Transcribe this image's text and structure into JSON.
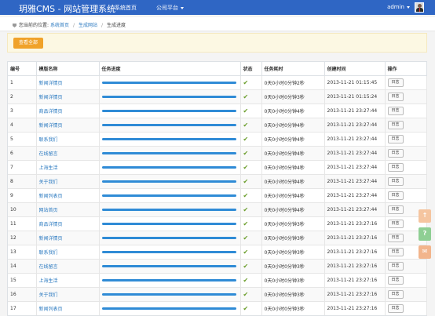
{
  "navbar": {
    "brand": "玥雅CMS - 网站管理系统",
    "home_link": "系统首页",
    "platform_link": "公司平台",
    "user": "admin"
  },
  "breadcrumb": {
    "prefix": "您当前的位置:",
    "items": [
      "系统首页",
      "生成网站",
      "生成进度"
    ]
  },
  "actions": {
    "view_all": "查看全部"
  },
  "table": {
    "columns": [
      "编号",
      "模版名称",
      "任务进度",
      "状态",
      "任务耗时",
      "创建时间",
      "操作"
    ],
    "rows": [
      {
        "id": "1",
        "name": "新闻详情页",
        "duration": "0天0小时0分钟2秒",
        "created": "2013-11-21 01:15:45",
        "action": "日志"
      },
      {
        "id": "2",
        "name": "新闻详情页",
        "duration": "0天0小时0分钟3秒",
        "created": "2013-11-21 01:15:24",
        "action": "日志"
      },
      {
        "id": "3",
        "name": "商品详情页",
        "duration": "0天0小时0分钟4秒",
        "created": "2013-11-21 23:27:44",
        "action": "日志"
      },
      {
        "id": "4",
        "name": "新闻详情页",
        "duration": "0天0小时0分钟4秒",
        "created": "2013-11-21 23:27:44",
        "action": "日志"
      },
      {
        "id": "5",
        "name": "联系我们",
        "duration": "0天0小时0分钟4秒",
        "created": "2013-11-21 23:27:44",
        "action": "日志"
      },
      {
        "id": "6",
        "name": "在线留言",
        "duration": "0天0小时0分钟4秒",
        "created": "2013-11-21 23:27:44",
        "action": "日志"
      },
      {
        "id": "7",
        "name": "上海生活",
        "duration": "0天0小时0分钟4秒",
        "created": "2013-11-21 23:27:44",
        "action": "日志"
      },
      {
        "id": "8",
        "name": "关于我们",
        "duration": "0天0小时0分钟4秒",
        "created": "2013-11-21 23:27:44",
        "action": "日志"
      },
      {
        "id": "9",
        "name": "新闻列表页",
        "duration": "0天0小时0分钟4秒",
        "created": "2013-11-21 23:27:44",
        "action": "日志"
      },
      {
        "id": "10",
        "name": "网站首页",
        "duration": "0天0小时0分钟4秒",
        "created": "2013-11-21 23:27:44",
        "action": "日志"
      },
      {
        "id": "11",
        "name": "商品详情页",
        "duration": "0天0小时0分钟3秒",
        "created": "2013-11-21 23:27:16",
        "action": "日志"
      },
      {
        "id": "12",
        "name": "新闻详情页",
        "duration": "0天0小时0分钟3秒",
        "created": "2013-11-21 23:27:16",
        "action": "日志"
      },
      {
        "id": "13",
        "name": "联系我们",
        "duration": "0天0小时0分钟3秒",
        "created": "2013-11-21 23:27:16",
        "action": "日志"
      },
      {
        "id": "14",
        "name": "在线留言",
        "duration": "0天0小时0分钟3秒",
        "created": "2013-11-21 23:27:16",
        "action": "日志"
      },
      {
        "id": "15",
        "name": "上海生活",
        "duration": "0天0小时0分钟3秒",
        "created": "2013-11-21 23:27:16",
        "action": "日志"
      },
      {
        "id": "16",
        "name": "关于我们",
        "duration": "0天0小时0分钟3秒",
        "created": "2013-11-21 23:27:16",
        "action": "日志"
      },
      {
        "id": "17",
        "name": "新闻列表页",
        "duration": "0天0小时0分钟3秒",
        "created": "2013-11-21 23:27:16",
        "action": "日志"
      }
    ]
  },
  "side_buttons": [
    {
      "icon": "back-to-top-icon",
      "glyph": "↑"
    },
    {
      "icon": "help-icon",
      "glyph": "?"
    },
    {
      "icon": "chat-icon",
      "glyph": "✉"
    }
  ],
  "colors": {
    "navbar": "#2f66c4",
    "progress": "#2f8bd6",
    "status_ok": "#6a9d2a",
    "link": "#2a79c0",
    "view_all_button": "#f0a22a"
  }
}
